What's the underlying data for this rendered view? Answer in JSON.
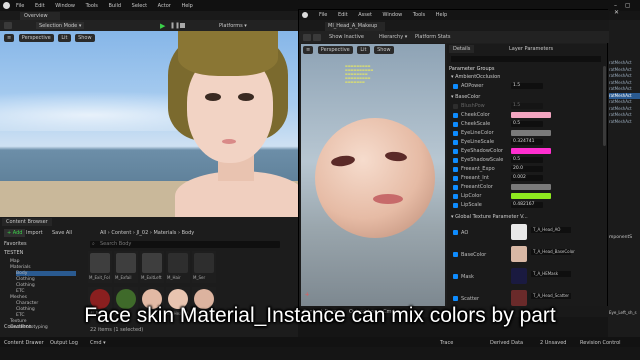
{
  "main_window": {
    "menu": [
      "File",
      "Edit",
      "Window",
      "Tools",
      "Build",
      "Select",
      "Actor",
      "Help"
    ],
    "tab": "Overview",
    "toolbar": {
      "mode": "Selection Mode",
      "platforms": "Platforms"
    },
    "viewport": {
      "perspective": "Perspective",
      "lit": "Lit",
      "show": "Show"
    }
  },
  "material_window": {
    "menu": [
      "File",
      "Edit",
      "Asset",
      "Window",
      "Tools",
      "Help"
    ],
    "tab": "MI_Head_A_Makeup",
    "toolbar": {
      "show_inactive": "Show Inactive",
      "hierarchy": "Hierarchy",
      "platform_stats": "Platform Stats"
    },
    "viewport": {
      "perspective": "Perspective",
      "lit": "Lit",
      "show": "Show"
    },
    "panels": {
      "details": "Details",
      "layer_parameters": "Layer Parameters"
    },
    "groups": {
      "parameter_groups": "Parameter Groups",
      "ambient": "AmbientOcclusion",
      "base_color": "BaseColor",
      "global_texture": "Global Texture Parameter V..."
    },
    "params": [
      {
        "label": "AOPower",
        "value": "1.5"
      },
      {
        "label": "BlushPow",
        "value": "1.5",
        "disabled": true
      },
      {
        "label": "CheekColor",
        "color": "#f2a5c0"
      },
      {
        "label": "CheekScale",
        "value": "0.5"
      },
      {
        "label": "EyeLineColor",
        "color": "#7a7a7a"
      },
      {
        "label": "EyeLineScale",
        "value": "0.324741"
      },
      {
        "label": "EyeShadowColor",
        "color": "#ff2fd0"
      },
      {
        "label": "EyeShadowScale",
        "value": "0.5"
      },
      {
        "label": "Freeant_Expo",
        "value": "20.0"
      },
      {
        "label": "Freeant_Int",
        "value": "0.002"
      },
      {
        "label": "FreeantColor",
        "color": "#7a7a7a"
      },
      {
        "label": "LipColor",
        "color": "#8ee81f"
      },
      {
        "label": "LipScale",
        "value": "0.482167"
      }
    ],
    "textures": [
      {
        "label": "AO",
        "name": "T_A_Head_AO"
      },
      {
        "label": "BaseColor",
        "name": "T_A_Head_BaseColor"
      },
      {
        "label": "Mask",
        "name": "T_A_HEMask"
      },
      {
        "label": "Scatter",
        "name": "T_A_Head_Scatter"
      }
    ],
    "bottom": {
      "content_drawer": "Content Drawer",
      "output_log": "Output Log",
      "cmd": "Cmd"
    }
  },
  "content_browser": {
    "title": "Content Browser",
    "add": "+ Add",
    "import": "Import",
    "save_all": "Save All",
    "path": [
      "All",
      "Content",
      "JI_02",
      "Materials",
      "Body"
    ],
    "search_placeholder": "Search Body",
    "favorites": "Favorites",
    "project": "TESTEN",
    "tree": [
      "Map",
      "Materials",
      "Body",
      "Clothing",
      "Clothing",
      "ETC",
      "Meshes",
      "Character",
      "Clothing",
      "ETC",
      "Texture",
      "LevelPrototyping"
    ],
    "collections": "Collections",
    "count": "22 items (1 selected)",
    "assets": [
      {
        "name": "M_Exit_Fol",
        "color": "#3e3e3e"
      },
      {
        "name": "M_Exfail",
        "color": "#3e3e3e"
      },
      {
        "name": "M_ExitLeft",
        "color": "#3e3e3e"
      },
      {
        "name": "M_Hair",
        "color": "#2e2e2e"
      },
      {
        "name": "M_Ser",
        "color": "#2e2e2e"
      },
      {
        "name": "MI_Red",
        "color": "#8a1f1f"
      },
      {
        "name": "MI_Leaf",
        "color": "#3f6a2a"
      },
      {
        "name": "MI_Skin",
        "color": "#e2b9a4"
      },
      {
        "name": "MI_Head_A",
        "color": "#e8c4b0"
      },
      {
        "name": "MI_Head_B",
        "color": "#dcb39f"
      }
    ]
  },
  "right_panel": {
    "mesh_labels": [
      "ratMeshAct",
      "ratMeshAct",
      "ratMeshAct",
      "ratMeshAct",
      "ratMeshAct",
      "ratMeshAct",
      "ratMeshAct",
      "ratMeshAct",
      "ratMeshAct",
      "ratMeshAct"
    ],
    "component": "mponentS",
    "eye_label": "Eye_Left_sh_s"
  },
  "status_bar": {
    "content_drawer": "Content Drawer",
    "output_log": "Output Log",
    "cmd": "Cmd",
    "trace": "Trace",
    "derived_data": "Derived Data",
    "unsaved": "2 Unsaved",
    "revision": "Revision Control"
  },
  "caption": "Face skin Material_Instance can mix colors by part",
  "colors": {
    "accent": "#0e8cff",
    "panel": "#242424",
    "bg": "#151515"
  }
}
